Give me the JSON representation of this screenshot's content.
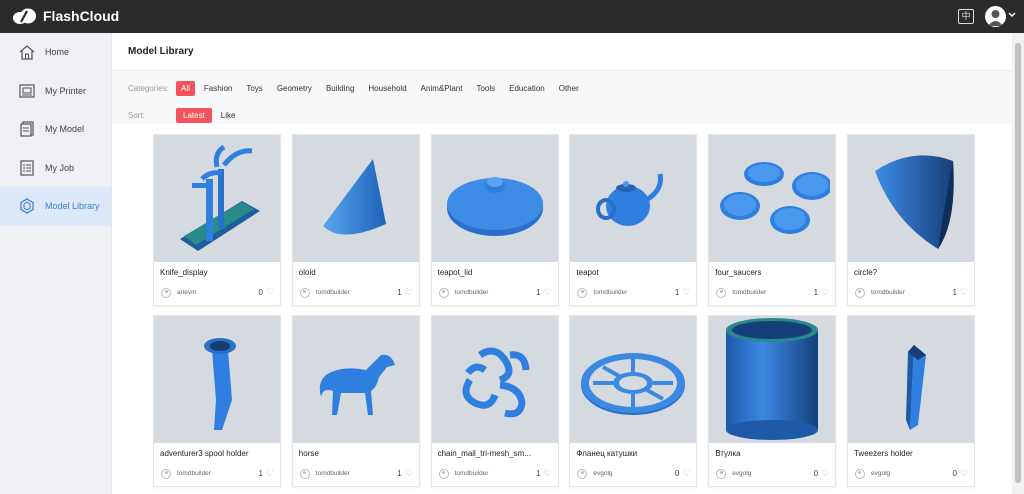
{
  "app": {
    "name": "FlashCloud",
    "lang_label": "中"
  },
  "sidebar": {
    "items": [
      {
        "label": "Home",
        "icon": "home-icon",
        "active": false
      },
      {
        "label": "My Printer",
        "icon": "printer-icon",
        "active": false
      },
      {
        "label": "My Model",
        "icon": "model-icon",
        "active": false
      },
      {
        "label": "My Job",
        "icon": "job-icon",
        "active": false
      },
      {
        "label": "Model Library",
        "icon": "library-icon",
        "active": true
      }
    ]
  },
  "main": {
    "title": "Model Library",
    "filters": {
      "categories_label": "Categories:",
      "categories": [
        "All",
        "Fashion",
        "Toys",
        "Geometry",
        "Building",
        "Household",
        "Anim&Plant",
        "Tools",
        "Education",
        "Other"
      ],
      "active_category": "All",
      "sort_label": "Sort:",
      "sorts": [
        "Latest",
        "Like"
      ],
      "active_sort": "Latest"
    },
    "models": [
      {
        "title": "Knife_display",
        "author": "arievm",
        "likes": "0",
        "icon": "knife-display-thumb"
      },
      {
        "title": "oloid",
        "author": "tomdbuilder",
        "likes": "1",
        "icon": "oloid-thumb"
      },
      {
        "title": "teapot_lid",
        "author": "tomdbuilder",
        "likes": "1",
        "icon": "teapot-lid-thumb"
      },
      {
        "title": "teapot",
        "author": "tomdbuilder",
        "likes": "1",
        "icon": "teapot-thumb"
      },
      {
        "title": "four_saucers",
        "author": "tomdbuilder",
        "likes": "1",
        "icon": "saucers-thumb"
      },
      {
        "title": "circle?",
        "author": "tomdbuilder",
        "likes": "1",
        "icon": "circle-thumb"
      },
      {
        "title": "adventurer3 spool holder",
        "author": "tomdbuilder",
        "likes": "1",
        "icon": "spool-holder-thumb"
      },
      {
        "title": "horse",
        "author": "tomdbuilder",
        "likes": "1",
        "icon": "horse-thumb"
      },
      {
        "title": "chain_mail_tri-mesh_sm...",
        "author": "tomdbuilder",
        "likes": "1",
        "icon": "chain-mail-thumb"
      },
      {
        "title": "Фланец катушки",
        "author": "evgolg",
        "likes": "0",
        "icon": "flange-thumb"
      },
      {
        "title": "Втулка",
        "author": "evgolg",
        "likes": "0",
        "icon": "sleeve-thumb"
      },
      {
        "title": "Tweezers holder",
        "author": "evgolg",
        "likes": "0",
        "icon": "tweezers-thumb"
      }
    ]
  },
  "colors": {
    "accent": "#f2545b",
    "topbar": "#2b2b2b",
    "active_side": "#3b7fd6",
    "model_blue": "#2f7fe0"
  }
}
